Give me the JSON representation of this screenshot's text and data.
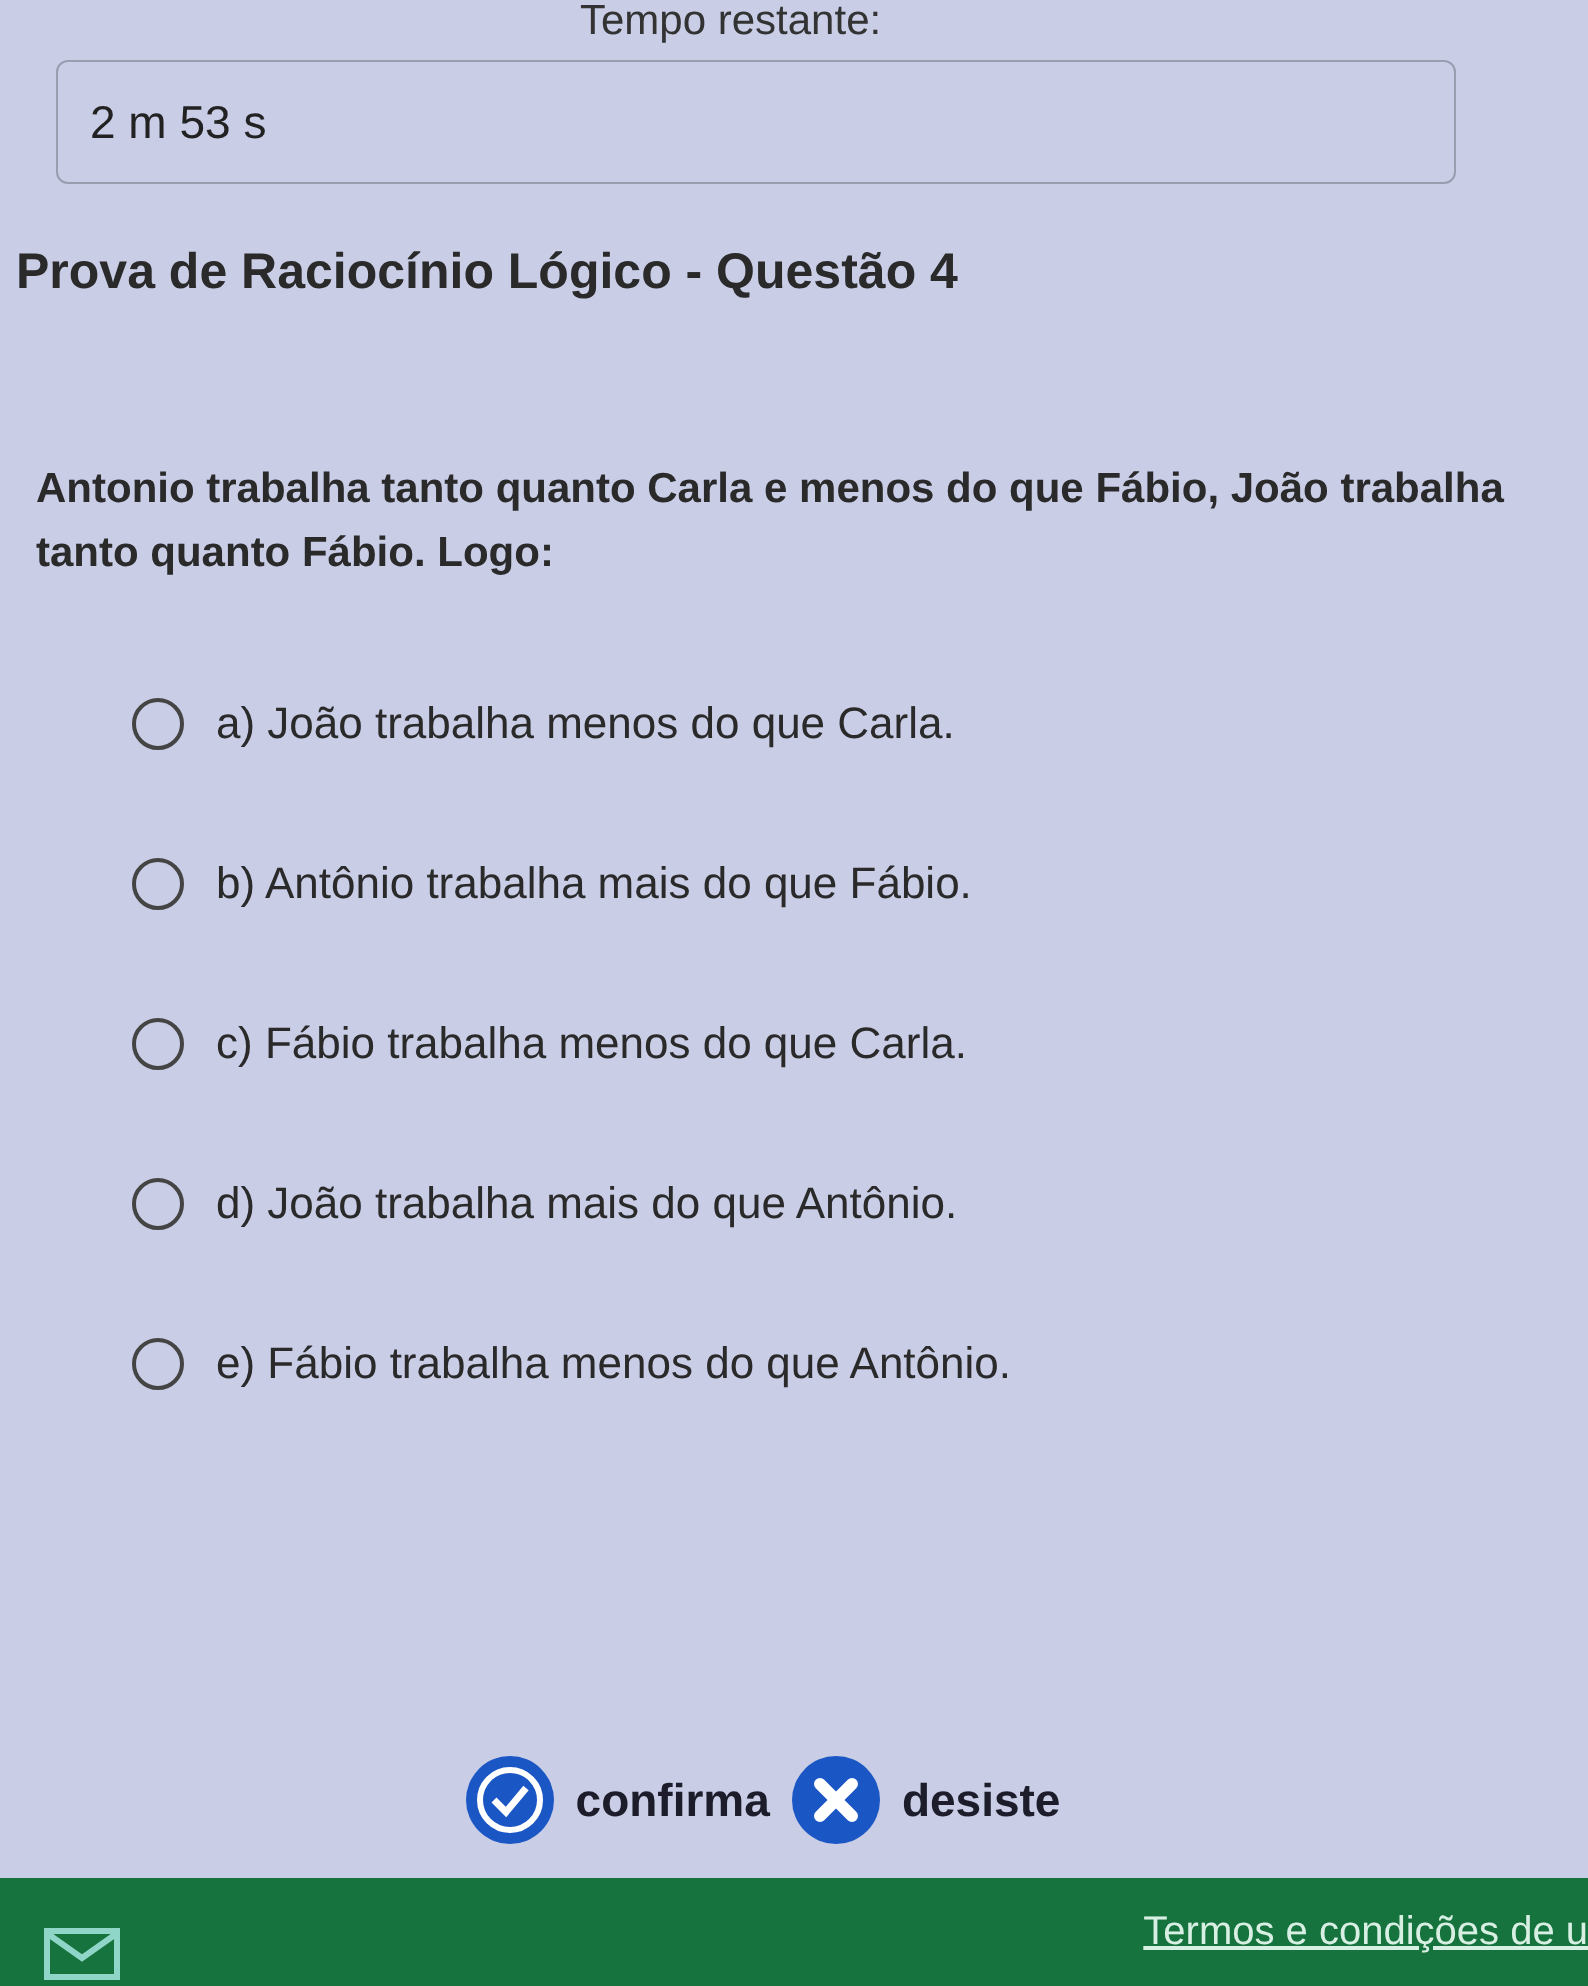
{
  "timer": {
    "label": "Tempo restante:",
    "value": "2 m 53 s"
  },
  "title": "Prova de Raciocínio Lógico - Questão 4",
  "question": "Antonio trabalha tanto quanto Carla e menos do que Fábio, João trabalha tanto quanto Fábio. Logo:",
  "options": [
    {
      "text": "a) João trabalha menos do que Carla.",
      "selected": false
    },
    {
      "text": "b) Antônio trabalha mais do que Fábio.",
      "selected": false
    },
    {
      "text": "c) Fábio trabalha menos do que Carla.",
      "selected": false
    },
    {
      "text": "d) João trabalha mais do que Antônio.",
      "selected": false
    },
    {
      "text": "e) Fábio trabalha menos do que Antônio.",
      "selected": false
    }
  ],
  "actions": [
    {
      "kind": "confirm",
      "label": "confirma"
    },
    {
      "kind": "cancel",
      "label": "desiste"
    }
  ],
  "footer": {
    "link": "Termos e condições de u"
  }
}
